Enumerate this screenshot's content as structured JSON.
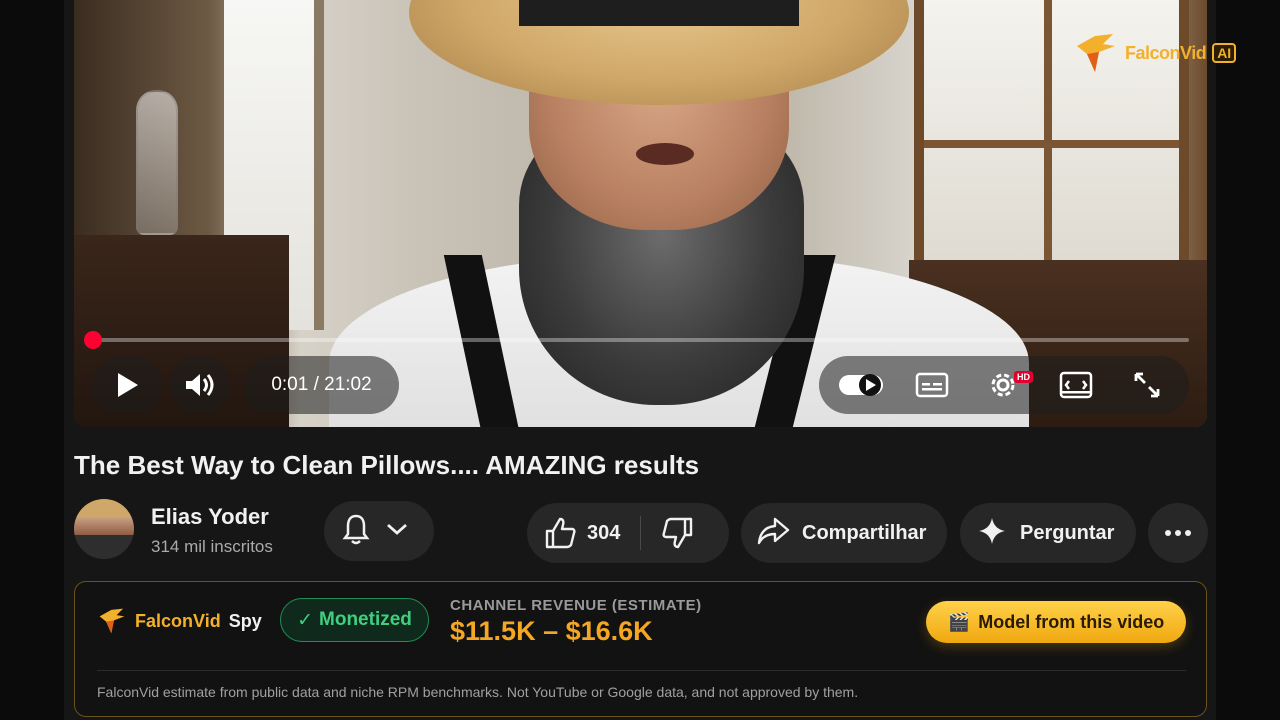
{
  "brand": {
    "name": "FalconVid",
    "ai_badge": "AI",
    "accent_color": "#f3b02c"
  },
  "player": {
    "current_time": "0:01",
    "duration": "21:02",
    "time_display": "0:01 / 21:02",
    "progress_fraction": 0.001,
    "quality_badge": "HD",
    "icons": [
      "play-icon",
      "volume-icon",
      "autoplay-toggle-icon",
      "captions-icon",
      "settings-icon",
      "miniplayer-icon",
      "fullscreen-icon"
    ]
  },
  "video": {
    "title": "The Best Way to Clean Pillows.... AMAZING results"
  },
  "channel": {
    "name": "Elias Yoder",
    "subscribers": "314 mil inscritos"
  },
  "actions": {
    "likes": "304",
    "share_label": "Compartilhar",
    "ask_label": "Perguntar"
  },
  "spy": {
    "brand_part1": "FalconVid",
    "brand_part2": "Spy",
    "monetized_label": "Monetized",
    "revenue_label": "CHANNEL REVENUE (ESTIMATE)",
    "revenue_value": "$11.5K – $16.6K",
    "model_button": "Model from this video",
    "disclaimer": "FalconVid estimate from public data and niche RPM benchmarks. Not YouTube or Google data, and not approved by them.",
    "monetized_color": "#3ecf7f",
    "revenue_color": "#f5a623"
  }
}
